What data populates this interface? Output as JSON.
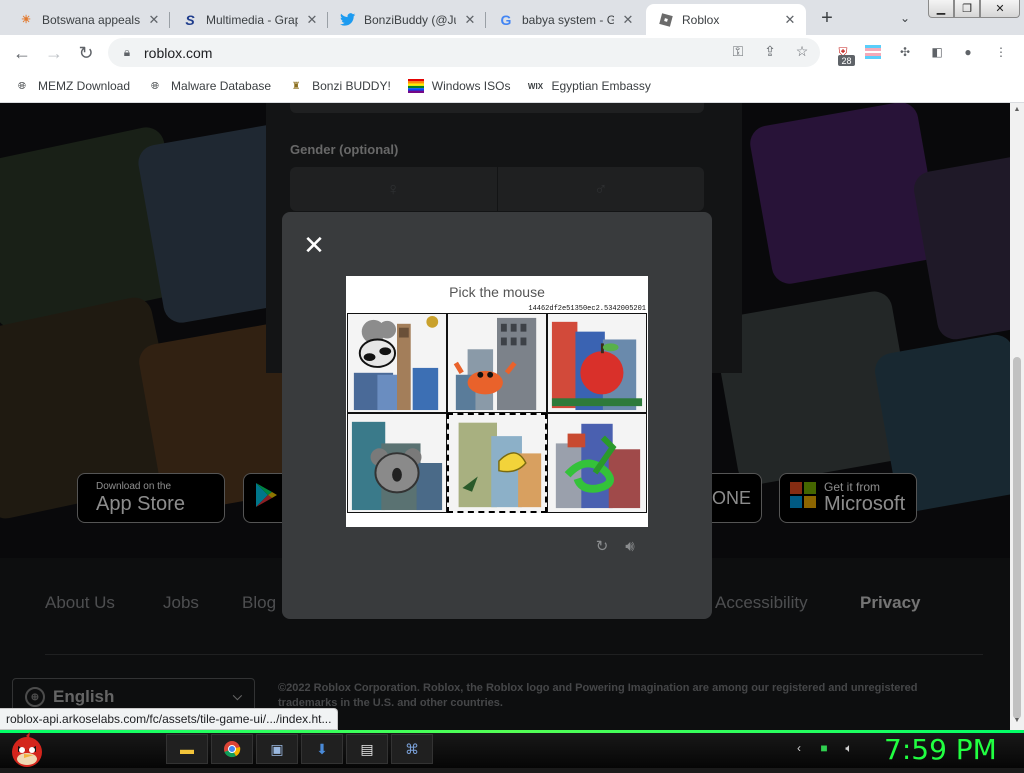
{
  "browser": {
    "tabs": [
      {
        "title": "Botswana appeals",
        "icon": "sun-favicon",
        "active": false
      },
      {
        "title": "Multimedia - Grap",
        "icon": "scribd-favicon",
        "active": false
      },
      {
        "title": "BonziBuddy (@Ju",
        "icon": "twitter-favicon",
        "active": false
      },
      {
        "title": "babya system - G",
        "icon": "google-favicon",
        "active": false
      },
      {
        "title": "Roblox",
        "icon": "roblox-favicon",
        "active": true
      }
    ],
    "new_tab": "+",
    "url": "roblox.com",
    "extension_badge": "28",
    "bookmarks": [
      {
        "label": "MEMZ Download",
        "icon": "globe-icon"
      },
      {
        "label": "Malware Database",
        "icon": "globe-icon"
      },
      {
        "label": "Bonzi BUDDY!",
        "icon": "trophy-icon"
      },
      {
        "label": "Windows ISOs",
        "icon": "rainbow-flag-icon"
      },
      {
        "label": "Egyptian Embassy",
        "icon": "wix-icon"
      }
    ],
    "status_url": "roblox-api.arkoselabs.com/fc/assets/tile-game-ui/.../index.ht..."
  },
  "signup": {
    "gender_label": "Gender (optional)"
  },
  "stores": [
    {
      "small": "Download on the",
      "big": "App Store"
    },
    {
      "small": "",
      "big": "ONE"
    },
    {
      "small": "Get it from",
      "big": "Microsoft"
    }
  ],
  "footer": {
    "links": [
      "About Us",
      "Jobs",
      "Blog",
      "Accessibility",
      "Privacy"
    ],
    "language": "English",
    "copyright": "©2022 Roblox Corporation. Roblox, the Roblox logo and Powering Imagination are among our registered and unregistered trademarks in the U.S. and other countries."
  },
  "captcha": {
    "prompt": "Pick the mouse",
    "puzzle_id": "14462df2e51350ec2.5342005201",
    "selected_index": 4,
    "tiles": [
      "panda-and-buildings",
      "crab-and-buildings",
      "apple-and-buildings",
      "koala-and-buildings",
      "banana-animal-and-buildings",
      "green-snake-and-buildings"
    ]
  },
  "taskbar": {
    "clock": "7:59 PM",
    "pinned": [
      "file-explorer-icon",
      "chrome-icon",
      "media-player-icon",
      "installer-icon",
      "notepad-icon",
      "network-icon"
    ]
  },
  "colors": {
    "clock_green": "#21ff41",
    "modal_bg": "#393b3d",
    "page_bg": "#111214"
  }
}
